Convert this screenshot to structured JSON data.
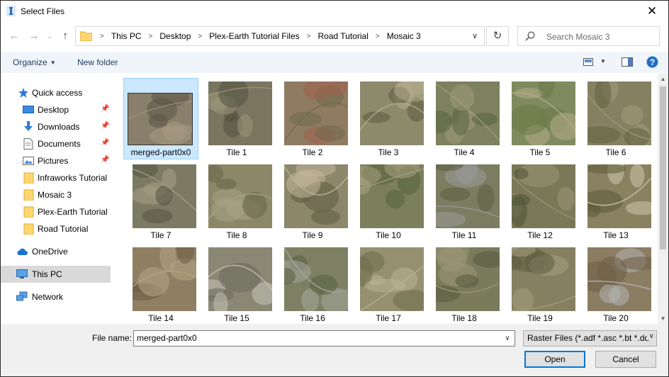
{
  "window": {
    "title": "Select Files"
  },
  "address": {
    "crumbs": [
      "This PC",
      "Desktop",
      "Plex-Earth Tutorial Files",
      "Road Tutorial",
      "Mosaic 3"
    ]
  },
  "search": {
    "placeholder": "Search Mosaic 3"
  },
  "toolbar": {
    "organize_label": "Organize",
    "new_folder_label": "New folder"
  },
  "sidebar": {
    "items": [
      {
        "label": "Quick access",
        "icon": "star-icon",
        "pinned": false
      },
      {
        "label": "Desktop",
        "icon": "desktop-icon",
        "pinned": true
      },
      {
        "label": "Downloads",
        "icon": "download-icon",
        "pinned": true
      },
      {
        "label": "Documents",
        "icon": "document-icon",
        "pinned": true
      },
      {
        "label": "Pictures",
        "icon": "pictures-icon",
        "pinned": true
      },
      {
        "label": "Infraworks Tutorial",
        "icon": "folder-icon",
        "pinned": false
      },
      {
        "label": "Mosaic 3",
        "icon": "folder-icon",
        "pinned": false
      },
      {
        "label": "Plex-Earth Tutorial F",
        "icon": "folder-icon",
        "pinned": false
      },
      {
        "label": "Road Tutorial",
        "icon": "folder-icon",
        "pinned": false
      },
      {
        "label": "OneDrive",
        "icon": "cloud-icon",
        "pinned": false
      },
      {
        "label": "This PC",
        "icon": "computer-icon",
        "pinned": false,
        "selected": true
      },
      {
        "label": "Network",
        "icon": "network-icon",
        "pinned": false
      }
    ]
  },
  "files": [
    {
      "label": "merged-part0x0",
      "selected": true,
      "colors": [
        "#8a7f6a",
        "#5c5445",
        "#a59a82"
      ]
    },
    {
      "label": "Tile 1",
      "colors": [
        "#7b7560",
        "#52503f",
        "#9d957a"
      ]
    },
    {
      "label": "Tile 2",
      "colors": [
        "#8f7b62",
        "#a0614a",
        "#6f6a4c"
      ]
    },
    {
      "label": "Tile 3",
      "colors": [
        "#8d8a6b",
        "#5d5a44",
        "#b5ab8c"
      ]
    },
    {
      "label": "Tile 4",
      "colors": [
        "#7d8160",
        "#5a6243",
        "#a09c7c"
      ]
    },
    {
      "label": "Tile 5",
      "colors": [
        "#7f8a5e",
        "#6a7a47",
        "#b4ad8b"
      ]
    },
    {
      "label": "Tile 6",
      "colors": [
        "#858061",
        "#60603f",
        "#9f9a7b"
      ]
    },
    {
      "label": "Tile 7",
      "colors": [
        "#7d7a63",
        "#545341",
        "#a59e85"
      ]
    },
    {
      "label": "Tile 8",
      "colors": [
        "#8b8768",
        "#666247",
        "#a9a285"
      ]
    },
    {
      "label": "Tile 9",
      "colors": [
        "#8c866a",
        "#5f5c44",
        "#c2b69a"
      ]
    },
    {
      "label": "Tile 10",
      "colors": [
        "#7c7f5c",
        "#56613d",
        "#a7a07f"
      ]
    },
    {
      "label": "Tile 11",
      "colors": [
        "#7c7c61",
        "#5d5d44",
        "#9b9b9b"
      ]
    },
    {
      "label": "Tile 12",
      "colors": [
        "#7a7858",
        "#4f5236",
        "#9b9575"
      ]
    },
    {
      "label": "Tile 13",
      "colors": [
        "#898160",
        "#5c5a3b",
        "#d0c7ad"
      ]
    },
    {
      "label": "Tile 14",
      "colors": [
        "#8e7f63",
        "#6a5b45",
        "#b5a585"
      ]
    },
    {
      "label": "Tile 15",
      "colors": [
        "#8a8774",
        "#6b6a5c",
        "#c6c4b8"
      ]
    },
    {
      "label": "Tile 16",
      "colors": [
        "#7d8062",
        "#585e41",
        "#a8a8a0"
      ]
    },
    {
      "label": "Tile 17",
      "colors": [
        "#95906f",
        "#6d6b4c",
        "#b9b293"
      ]
    },
    {
      "label": "Tile 18",
      "colors": [
        "#7a7a5d",
        "#55583c",
        "#9c9878"
      ]
    },
    {
      "label": "Tile 19",
      "colors": [
        "#868062",
        "#5d5b41",
        "#a59e80"
      ]
    },
    {
      "label": "Tile 20",
      "colors": [
        "#8b7d62",
        "#6e5e46",
        "#b4b4b4"
      ]
    }
  ],
  "footer": {
    "file_name_label": "File name:",
    "file_name_value": "merged-part0x0",
    "file_type_value": "Raster Files (*.adf *.asc *.bt *.dd",
    "open_label": "Open",
    "cancel_label": "Cancel"
  },
  "colors": {
    "accent": "#0078d7",
    "selection": "#cce8ff",
    "toolbar_text": "#1e3a5f"
  }
}
